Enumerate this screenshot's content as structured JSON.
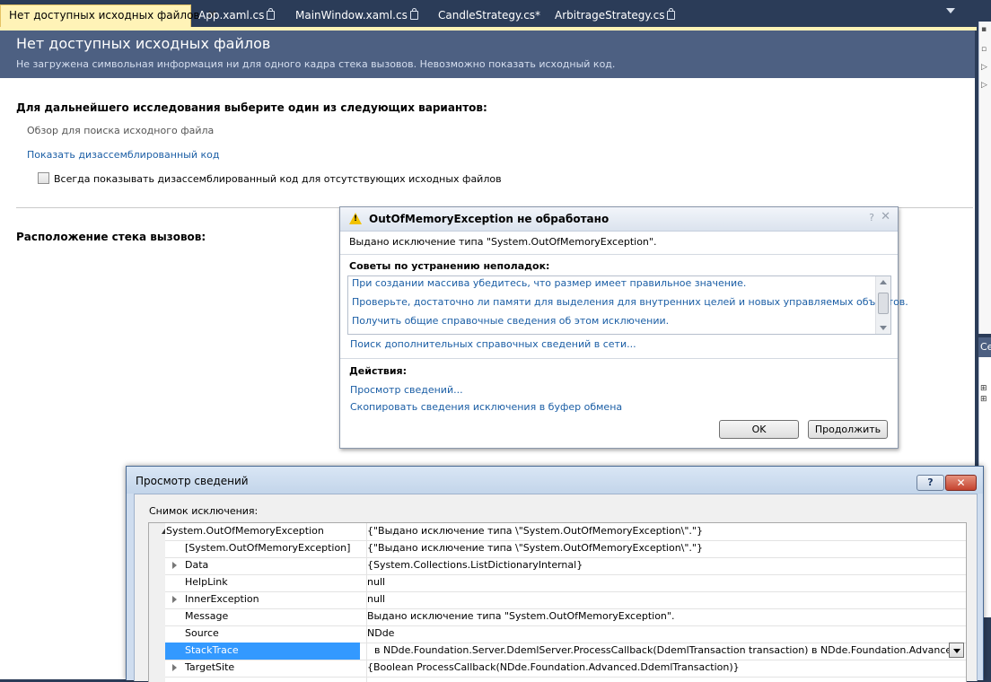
{
  "tabs": [
    {
      "label": "Нет доступных исходных файлов",
      "active": true,
      "locked": false
    },
    {
      "label": "App.xaml.cs",
      "active": false,
      "locked": true
    },
    {
      "label": "MainWindow.xaml.cs",
      "active": false,
      "locked": true
    },
    {
      "label": "CandleStrategy.cs*",
      "active": false,
      "locked": false
    },
    {
      "label": "ArbitrageStrategy.cs",
      "active": false,
      "locked": true
    }
  ],
  "tab_close_glyph": "✕",
  "doc": {
    "title": "Нет доступных исходных файлов",
    "subtitle": "Не загружена символьная информация ни для одного кадра стека вызовов. Невозможно показать исходный код.",
    "options_heading": "Для дальнейшего исследования выберите один из следующих вариантов:",
    "browse_link": "Обзор для поиска исходного файла",
    "show_disasm_link": "Показать дизассемблированный код",
    "always_show_label": "Всегда показывать дизассемблированный код для отсутствующих исходных файлов",
    "stack_heading": "Расположение стека вызовов:"
  },
  "right_panel": {
    "mid_label": "Се"
  },
  "exception_helper": {
    "title": "OutOfMemoryException не обработано",
    "help_glyph": "?",
    "close_glyph": "✕",
    "message": "Выдано исключение типа \"System.OutOfMemoryException\".",
    "tips_heading": "Советы по устранению неполадок:",
    "tips": [
      "При создании массива убедитесь, что размер имеет правильное значение.",
      "Проверьте, достаточно ли памяти для выделения для внутренних целей и новых управляемых объектов.",
      "Получить общие справочные сведения об этом исключении."
    ],
    "search_online": "Поиск дополнительных справочных сведений в сети...",
    "actions_heading": "Действия:",
    "view_details": "Просмотр сведений...",
    "copy_details": "Скопировать сведения исключения в буфер обмена",
    "ok_label": "OK",
    "continue_label": "Продолжить"
  },
  "details_dialog": {
    "title": "Просмотр сведений",
    "help_glyph": "?",
    "close_glyph": "✕",
    "snapshot_label": "Снимок исключения:",
    "rows": [
      {
        "name": "System.OutOfMemoryException",
        "value": "{\"Выдано исключение типа \\\"System.OutOfMemoryException\\\".\"}",
        "expander": "open",
        "indent": 0
      },
      {
        "name": "[System.OutOfMemoryException]",
        "value": "{\"Выдано исключение типа \\\"System.OutOfMemoryException\\\".\"}",
        "expander": "none",
        "indent": 1
      },
      {
        "name": "Data",
        "value": "{System.Collections.ListDictionaryInternal}",
        "expander": "closed",
        "indent": 1
      },
      {
        "name": "HelpLink",
        "value": "null",
        "expander": "none",
        "indent": 1
      },
      {
        "name": "InnerException",
        "value": "null",
        "expander": "closed",
        "indent": 1
      },
      {
        "name": "Message",
        "value": "Выдано исключение типа \"System.OutOfMemoryException\".",
        "expander": "none",
        "indent": 1
      },
      {
        "name": "Source",
        "value": "NDde",
        "expander": "none",
        "indent": 1
      },
      {
        "name": "StackTrace",
        "value": "   в NDde.Foundation.Server.DdemlServer.ProcessCallback(DdemlTransaction transaction)   в NDde.Foundation.Advanced.D",
        "expander": "none",
        "indent": 1,
        "selected": true
      },
      {
        "name": "TargetSite",
        "value": "{Boolean ProcessCallback(NDde.Foundation.Advanced.DdemlTransaction)}",
        "expander": "closed",
        "indent": 1
      }
    ]
  },
  "colors": {
    "tab_active": "#fff3b7",
    "header_bar": "#4d6082",
    "link": "#1b5ea5",
    "selection": "#3399ff"
  }
}
